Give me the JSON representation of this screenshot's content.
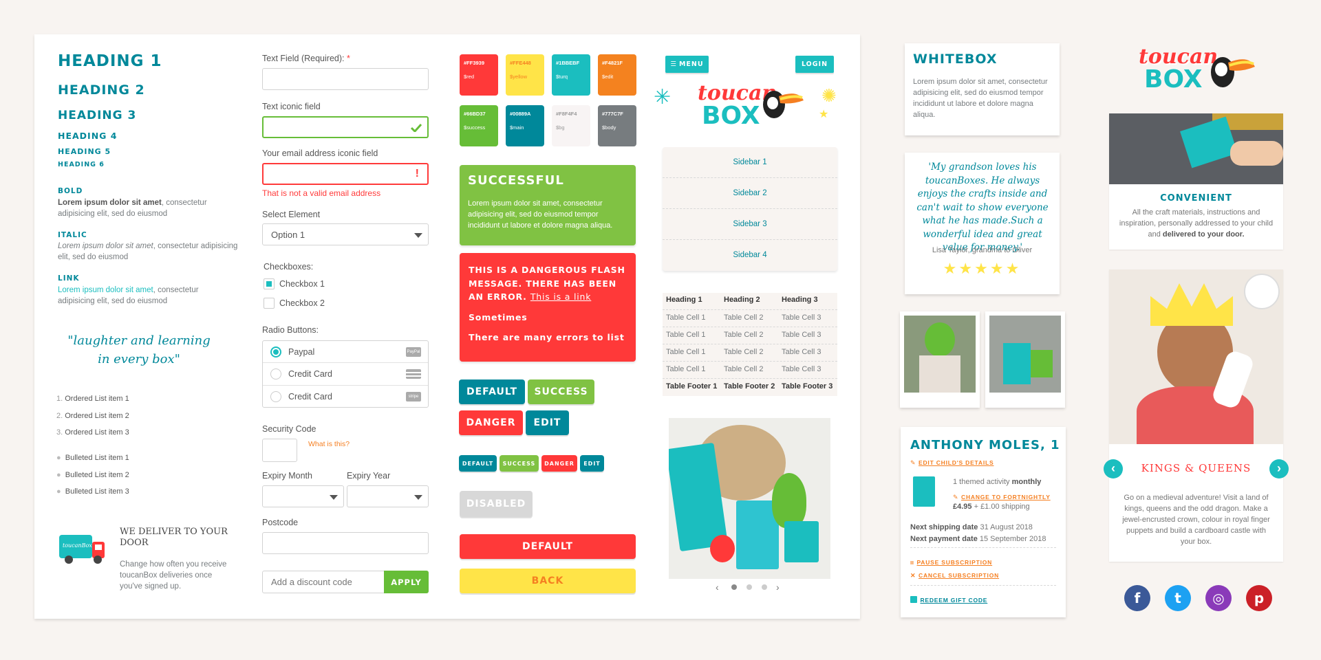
{
  "colors": {
    "red": "#FF3939",
    "yellow": "#FFE448",
    "turq": "#1BBEBF",
    "edit": "#F4821F",
    "success": "#66BD37",
    "main": "#00889A",
    "bg": "#F8F4F1",
    "body": "#777C7F"
  },
  "typography": {
    "h1": "HEADING 1",
    "h2": "HEADING 2",
    "h3": "HEADING 3",
    "h4": "HEADING 4",
    "h5": "HEADING 5",
    "h6": "HEADING 6",
    "bold_label": "BOLD",
    "bold_strong": "Lorem ipsum dolor sit amet",
    "bold_rest": ", consectetur adipisicing elit, sed do eiusmod",
    "italic_label": "ITALIC",
    "italic_em": "Lorem ipsum dolor sit amet",
    "italic_rest": ", consectetur adipisicing elit, sed do eiusmod",
    "link_label": "LINK",
    "link_text": "Lorem ipsum dolor sit amet",
    "link_rest": ", consectetur adipisicing elit, sed do eiusmod",
    "quote": "\"laughter and learning in every box\"",
    "ordered": [
      "Ordered List item 1",
      "Ordered List item 2",
      "Ordered List item 3"
    ],
    "bulleted": [
      "Bulleted List item 1",
      "Bulleted List item 2",
      "Bulleted List item 3"
    ],
    "deliver_title": "WE DELIVER TO YOUR DOOR",
    "deliver_text": "Change how often you receive toucanBox deliveries once you've signed up.",
    "van_text": "toucanBox"
  },
  "form": {
    "text_label": "Text Field (Required):",
    "required_mark": "*",
    "iconic_label": "Text iconic field",
    "email_label": "Your email address iconic field",
    "email_error": "That is not a valid email address",
    "select_label": "Select Element",
    "select_value": "Option 1",
    "checkboxes_label": "Checkboxes:",
    "checkbox1": "Checkbox 1",
    "checkbox2": "Checkbox 2",
    "radio_label": "Radio Buttons:",
    "radios": [
      "Paypal",
      "Credit Card",
      "Credit Card"
    ],
    "radio_badges": [
      "PayPal",
      "",
      "stripe"
    ],
    "security_label": "Security Code",
    "what_is_this": "What is this?",
    "month_label": "Expiry Month",
    "year_label": "Expiry Year",
    "postcode_label": "Postcode",
    "discount_placeholder": "Add a discount code",
    "apply": "APPLY"
  },
  "swatches": [
    {
      "hex": "#FF3939",
      "name": "$red"
    },
    {
      "hex": "#FFE448",
      "name": "$yellow"
    },
    {
      "hex": "#1BBEBF",
      "name": "$turq"
    },
    {
      "hex": "#F4821F",
      "name": "$edit"
    },
    {
      "hex": "#66BD37",
      "name": "$success"
    },
    {
      "hex": "#00889A",
      "name": "$main"
    },
    {
      "hex": "#F8F4F4",
      "name": "$bg"
    },
    {
      "hex": "#777C7F",
      "name": "$body"
    }
  ],
  "flash": {
    "success_title": "SUCCESSFUL",
    "success_text": "Lorem ipsum dolor sit amet, consectetur adipisicing elit, sed do eiusmod tempor incididunt ut labore et dolore magna aliqua.",
    "danger_text": "THIS IS A DANGEROUS FLASH MESSAGE. THERE HAS BEEN AN ERROR.",
    "danger_link": "This is a link",
    "danger_line2": "Sometimes",
    "danger_line3": "There are many errors to list"
  },
  "buttons": {
    "default": "DEFAULT",
    "success": "SUCCESS",
    "danger": "DANGER",
    "edit": "EDIT",
    "disabled": "DISABLED",
    "back": "BACK"
  },
  "nav": {
    "menu": "MENU",
    "login": "LOGIN",
    "logo_top": "toucan",
    "logo_bottom": "BOX",
    "sidebar": [
      "Sidebar 1",
      "Sidebar 2",
      "Sidebar 3",
      "Sidebar 4"
    ]
  },
  "table": {
    "headers": [
      "Heading 1",
      "Heading 2",
      "Heading 3"
    ],
    "rows": [
      [
        "Table Cell 1",
        "Table Cell 2",
        "Table Cell 3"
      ],
      [
        "Table Cell 1",
        "Table Cell 2",
        "Table Cell 3"
      ],
      [
        "Table Cell 1",
        "Table Cell 2",
        "Table Cell 3"
      ],
      [
        "Table Cell 1",
        "Table Cell 2",
        "Table Cell 3"
      ]
    ],
    "footer": [
      "Table Footer 1",
      "Table Footer 2",
      "Table Footer 3"
    ]
  },
  "carousel": {
    "active_dot": 0,
    "dots": 3
  },
  "whitebox": {
    "title": "WHITEBOX",
    "text": "Lorem ipsum dolor sit amet, consectetur adipisicing elit, sed do eiusmod tempor incididunt ut labore et dolore magna aliqua."
  },
  "testimonial": {
    "quote": "'My grandson loves his toucanBoxes. He always enjoys the crafts inside and can't wait to show everyone what he has made.Such a wonderful idea and great value for money.'",
    "author": "Lisa Taylor, grandma to Oliver",
    "stars": 5
  },
  "child": {
    "name": "ANTHONY MOLES, 1",
    "edit_link": "EDIT CHILD'S DETAILS",
    "plan_a": "1 themed activity ",
    "plan_b": "monthly",
    "change_link": "CHANGE TO FORTNIGHTLY",
    "price": "£4.95",
    "shipping": " + £1.00 shipping",
    "next_ship_label": "Next shipping date",
    "next_ship": " 31 August 2018",
    "next_pay_label": "Next payment date",
    "next_pay": " 15 September 2018",
    "pause": "PAUSE SUBSCRIPTION",
    "cancel": "CANCEL SUBSCRIPTION",
    "redeem": "REDEEM GIFT CODE"
  },
  "convenient": {
    "title": "CONVENIENT",
    "text_a": "All the craft materials, instructions and inspiration, personally addressed to your child and ",
    "text_b": "delivered to your door."
  },
  "kings": {
    "title": "KINGS & QUEENS",
    "text": "Go on a medieval adventure! Visit a land of kings, queens and the odd dragon. Make a jewel-encrusted crown, colour in royal finger puppets and build a cardboard castle with your box."
  },
  "social": {
    "facebook": "#3b5998",
    "twitter": "#1da1f2",
    "instagram": "#8a3ab9",
    "pinterest": "#cb2027"
  }
}
